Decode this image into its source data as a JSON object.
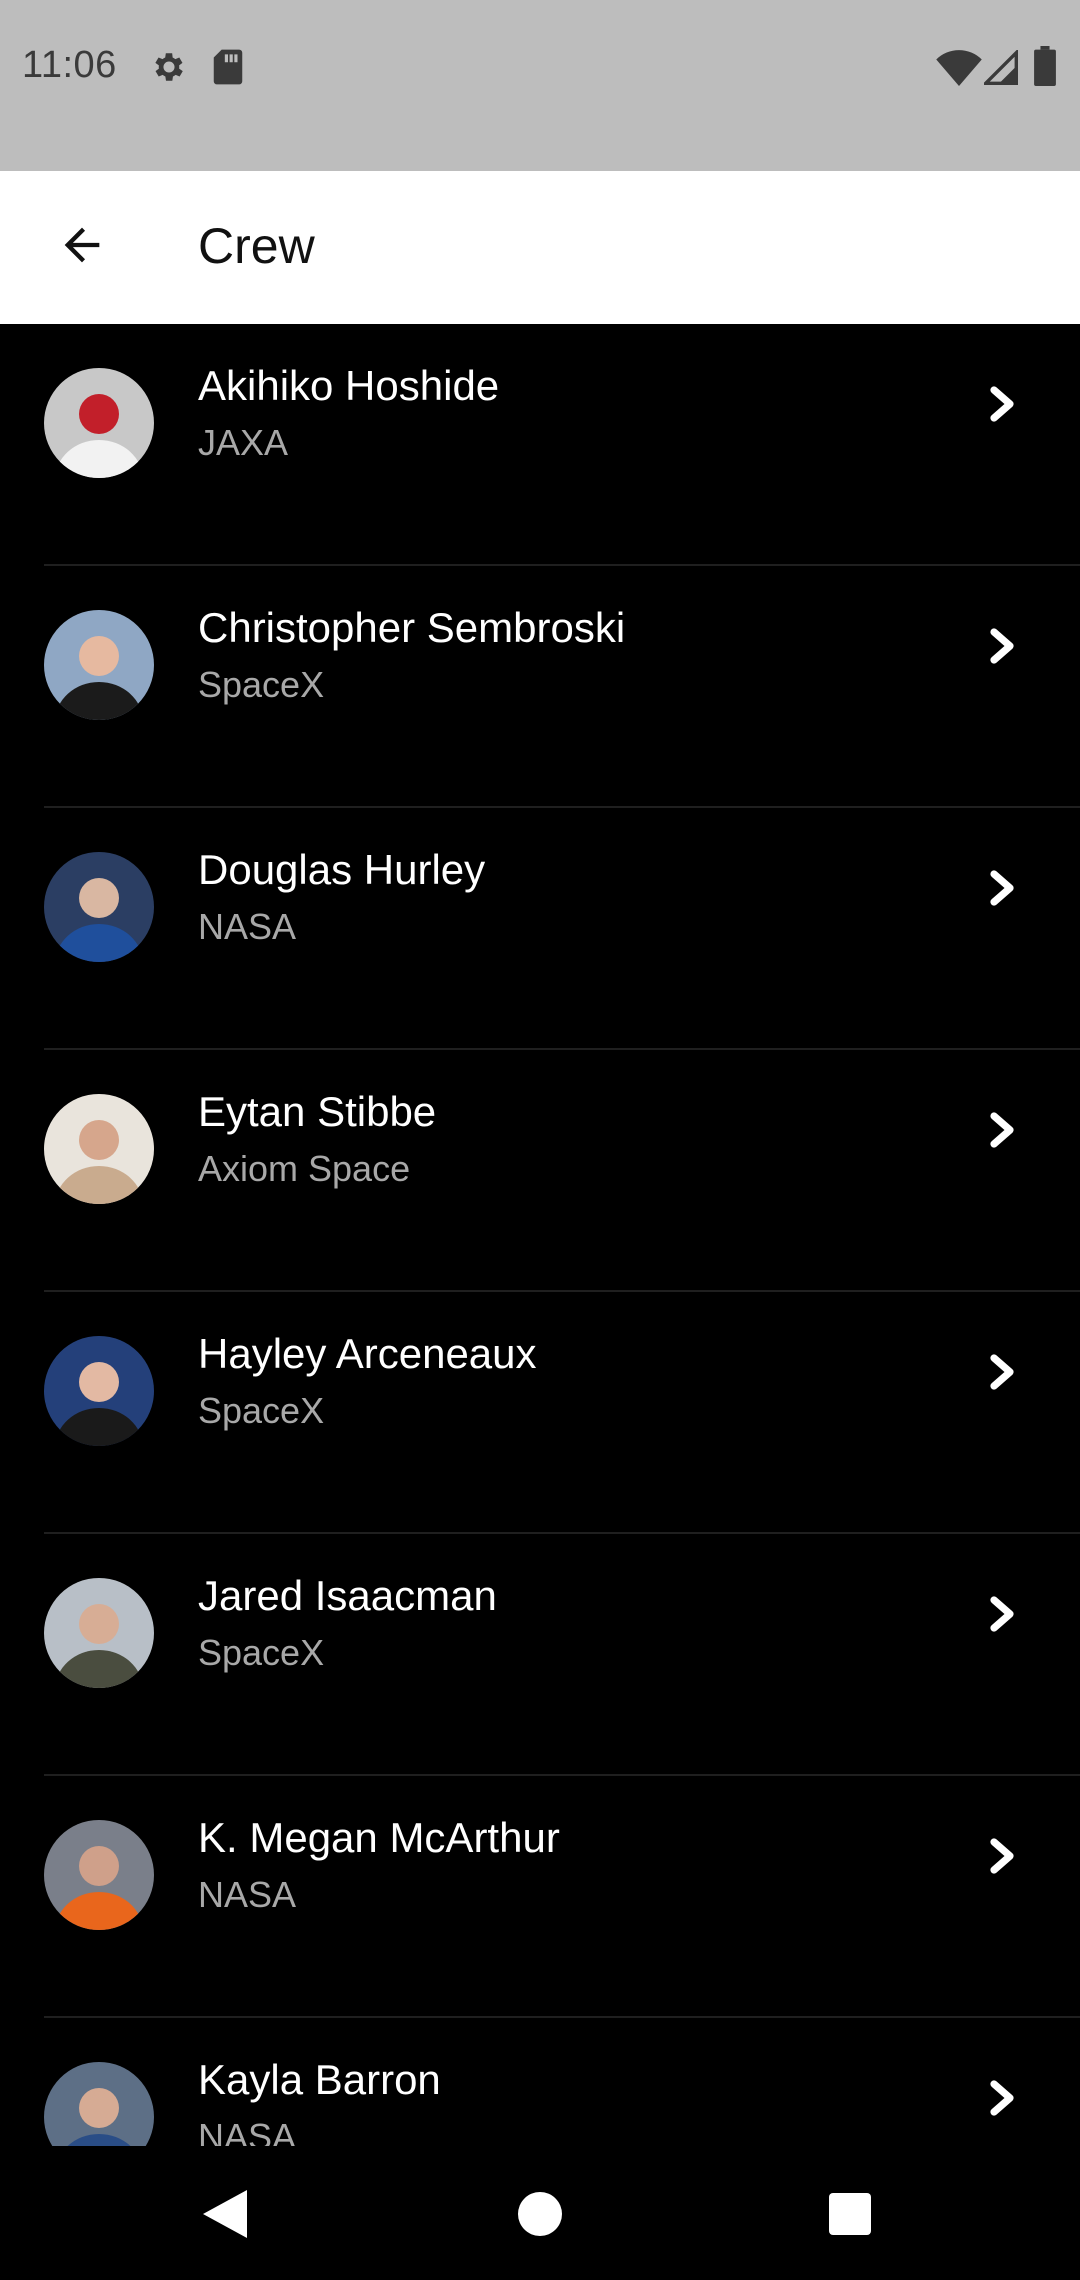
{
  "status_bar": {
    "time": "11:06",
    "icons": [
      "settings-gear-icon",
      "sd-card-icon",
      "wifi-icon",
      "cell-signal-icon",
      "battery-icon"
    ]
  },
  "app_bar": {
    "title": "Crew",
    "back_icon": "arrow-back-icon"
  },
  "crew": [
    {
      "name": "Akihiko Hoshide",
      "agency": "JAXA",
      "avatar": {
        "bg": "#c8c8c8",
        "body": "#f2f2f2",
        "accent": "#c21f2a"
      }
    },
    {
      "name": "Christopher Sembroski",
      "agency": "SpaceX",
      "avatar": {
        "bg": "#8fa7c4",
        "body": "#1b1b1b",
        "accent": "#e6b9a0"
      }
    },
    {
      "name": "Douglas Hurley",
      "agency": "NASA",
      "avatar": {
        "bg": "#2b3e63",
        "body": "#1f4f9c",
        "accent": "#d9b7a2"
      }
    },
    {
      "name": "Eytan Stibbe",
      "agency": "Axiom Space",
      "avatar": {
        "bg": "#e9e4dc",
        "body": "#c9ab8e",
        "accent": "#d6a68c"
      }
    },
    {
      "name": "Hayley Arceneaux",
      "agency": "SpaceX",
      "avatar": {
        "bg": "#24407a",
        "body": "#1a1a1a",
        "accent": "#e3b9a3"
      }
    },
    {
      "name": "Jared Isaacman",
      "agency": "SpaceX",
      "avatar": {
        "bg": "#b8bfc7",
        "body": "#4a4d3f",
        "accent": "#d7ad95"
      }
    },
    {
      "name": "K. Megan McArthur",
      "agency": "NASA",
      "avatar": {
        "bg": "#7a7f8a",
        "body": "#e9661c",
        "accent": "#cfa08a"
      }
    },
    {
      "name": "Kayla Barron",
      "agency": "NASA",
      "avatar": {
        "bg": "#5d6f86",
        "body": "#2a4d86",
        "accent": "#d6ab94"
      }
    }
  ],
  "row_icons": {
    "trailing": "chevron-right-icon"
  },
  "nav_bar": {
    "buttons": [
      "back-triangle-icon",
      "home-circle-icon",
      "recents-square-icon"
    ]
  },
  "colors": {
    "status_bar_bg": "#bdbdbd",
    "app_bar_bg": "#ffffff",
    "list_bg": "#000000",
    "name_text": "#ffffff",
    "agency_text": "#a8a8a8"
  }
}
